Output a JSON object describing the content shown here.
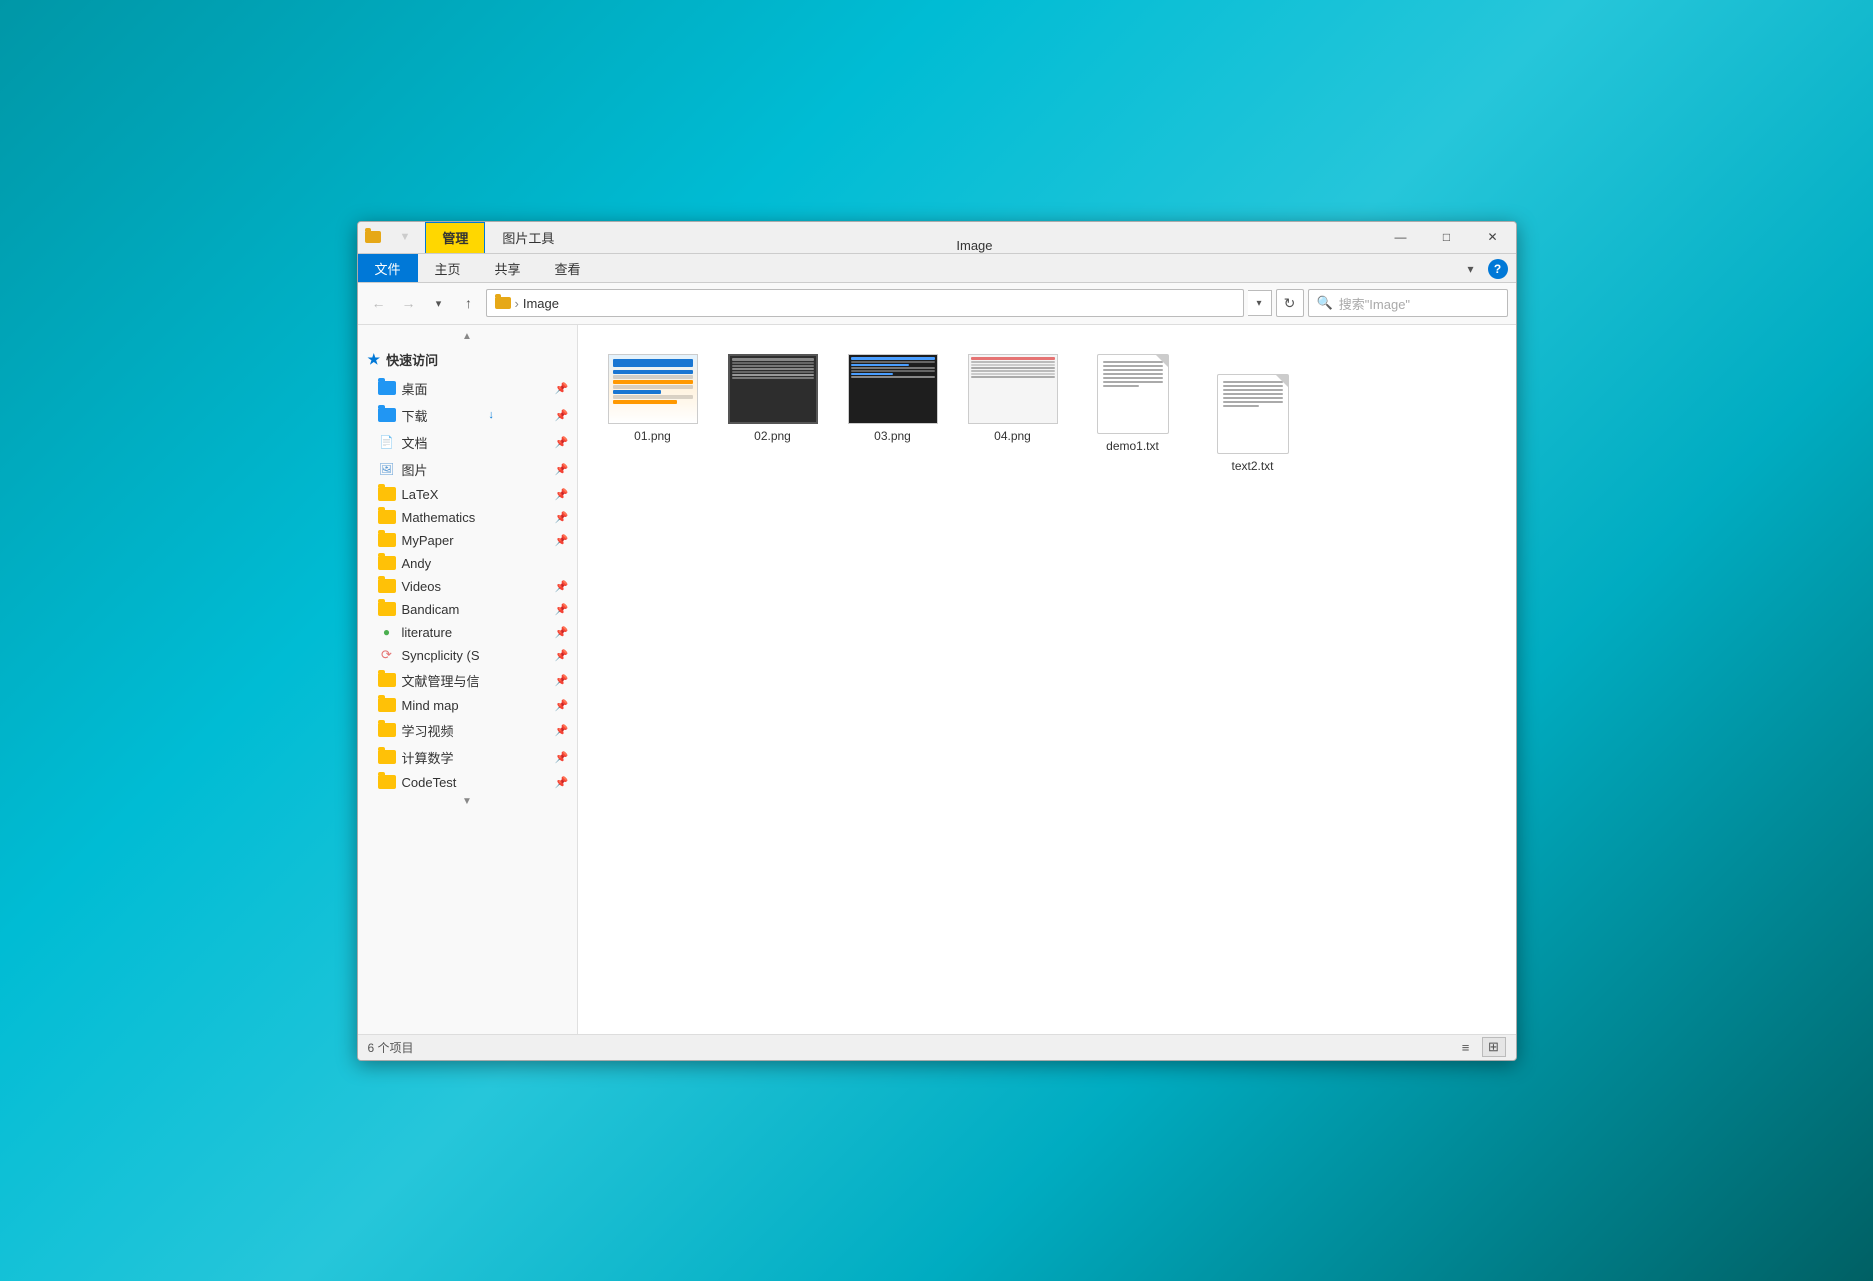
{
  "window": {
    "title": "Image",
    "manage_tab": "管理",
    "image_tools_tab": "图片工具"
  },
  "ribbon": {
    "tabs": [
      "文件",
      "主页",
      "共享",
      "查看"
    ],
    "active_tab": "文件"
  },
  "address_bar": {
    "path": "Image",
    "path_separator": ">",
    "search_placeholder": "搜索\"Image\""
  },
  "sidebar": {
    "quick_access_label": "快速访问",
    "items": [
      {
        "label": "桌面",
        "type": "folder-blue",
        "pinned": true
      },
      {
        "label": "下载",
        "type": "folder-dl",
        "pinned": true
      },
      {
        "label": "文档",
        "type": "doc",
        "pinned": true
      },
      {
        "label": "图片",
        "type": "img",
        "pinned": true
      },
      {
        "label": "LaTeX",
        "type": "folder",
        "pinned": true
      },
      {
        "label": "Mathematics",
        "type": "folder",
        "pinned": true
      },
      {
        "label": "MyPaper",
        "type": "folder",
        "pinned": true
      },
      {
        "label": "Andy",
        "type": "folder",
        "pinned": false
      },
      {
        "label": "Videos",
        "type": "folder",
        "pinned": true
      },
      {
        "label": "Bandicam",
        "type": "folder",
        "pinned": true
      },
      {
        "label": "literature",
        "type": "green",
        "pinned": true
      },
      {
        "label": "Syncplicity (S",
        "type": "sync",
        "pinned": true
      },
      {
        "label": "文献管理与信",
        "type": "folder",
        "pinned": true
      },
      {
        "label": "Mind map",
        "type": "folder",
        "pinned": true
      },
      {
        "label": "学习视频",
        "type": "folder",
        "pinned": true
      },
      {
        "label": "计算数学",
        "type": "folder",
        "pinned": true
      },
      {
        "label": "CodeTest",
        "type": "folder",
        "pinned": true
      }
    ]
  },
  "files": [
    {
      "name": "01.png",
      "type": "image-thumb"
    },
    {
      "name": "02.png",
      "type": "image-thumb"
    },
    {
      "name": "03.png",
      "type": "image-thumb"
    },
    {
      "name": "04.png",
      "type": "image-thumb"
    },
    {
      "name": "demo1.txt",
      "type": "txt"
    },
    {
      "name": "text2.txt",
      "type": "txt"
    }
  ],
  "status_bar": {
    "count_text": "6 个项目"
  }
}
